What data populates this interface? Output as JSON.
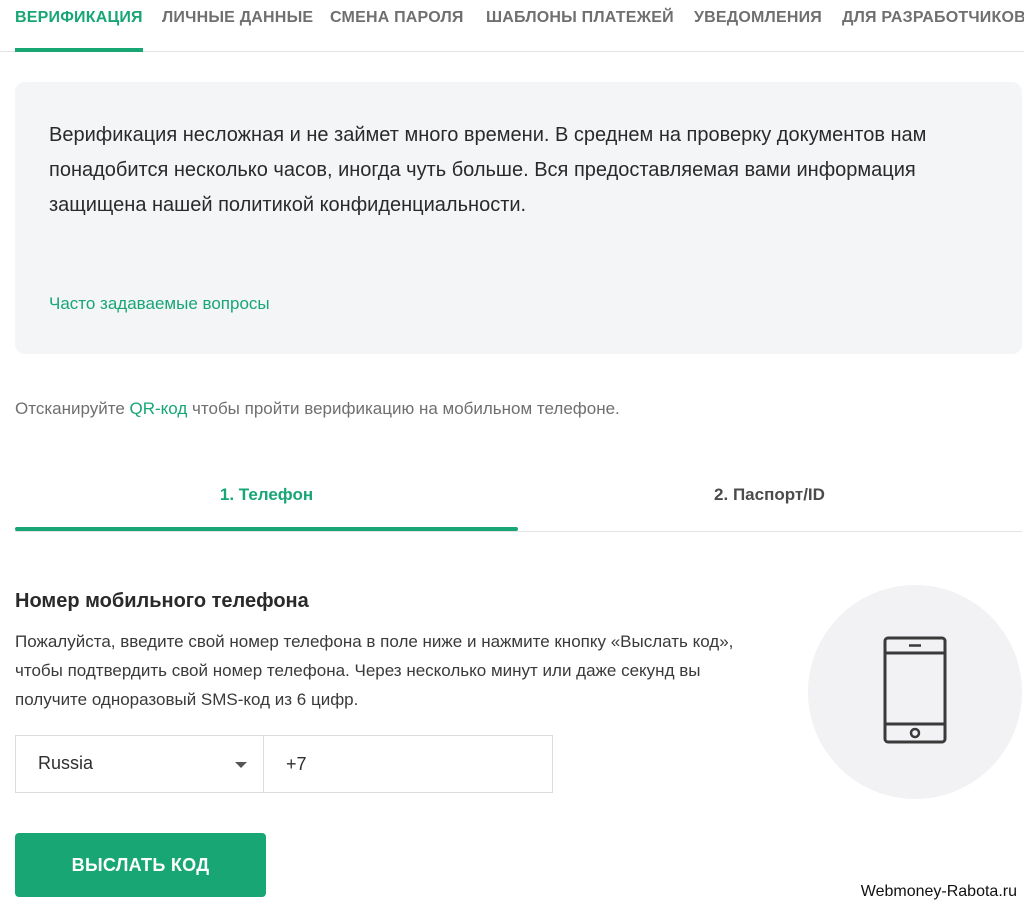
{
  "top_tabs": [
    {
      "label": "ВЕРИФИКАЦИЯ",
      "active": true
    },
    {
      "label": "ЛИЧНЫЕ ДАННЫЕ",
      "active": false
    },
    {
      "label": "СМЕНА ПАРОЛЯ",
      "active": false
    },
    {
      "label": "ШАБЛОНЫ ПЛАТЕЖЕЙ",
      "active": false
    },
    {
      "label": "УВЕДОМЛЕНИЯ",
      "active": false
    },
    {
      "label": "ДЛЯ РАЗРАБОТЧИКОВ",
      "active": false
    }
  ],
  "info_box": {
    "text": "Верификация несложная и не займет много времени. В среднем на проверку документов нам понадобится несколько часов, иногда чуть больше. Вся предоставляемая вами информация защищена нашей политикой конфиденциальности.",
    "faq_link": "Часто задаваемые вопросы"
  },
  "qr": {
    "prefix": "Отсканируйте ",
    "link": "QR-код",
    "suffix": " чтобы пройти верификацию на мобильном телефоне."
  },
  "steps": [
    {
      "label": "1. Телефон",
      "active": true
    },
    {
      "label": "2. Паспорт/ID",
      "active": false
    }
  ],
  "phone_section": {
    "title": "Номер мобильного телефона",
    "description": "Пожалуйста, введите свой номер телефона в поле ниже и нажмите кнопку «Выслать код», чтобы подтвердить свой номер телефона. Через несколько минут или даже секунд вы получите одноразовый SMS-код из 6 цифр.",
    "country": "Russia",
    "phone_value": "+7",
    "send_button": "ВЫСЛАТЬ КОД",
    "icon": "smartphone-icon"
  },
  "watermark": "Webmoney-Rabota.ru",
  "colors": {
    "accent": "#17a674",
    "panel_bg": "#f4f5f7",
    "circle_bg": "#f2f2f4"
  }
}
